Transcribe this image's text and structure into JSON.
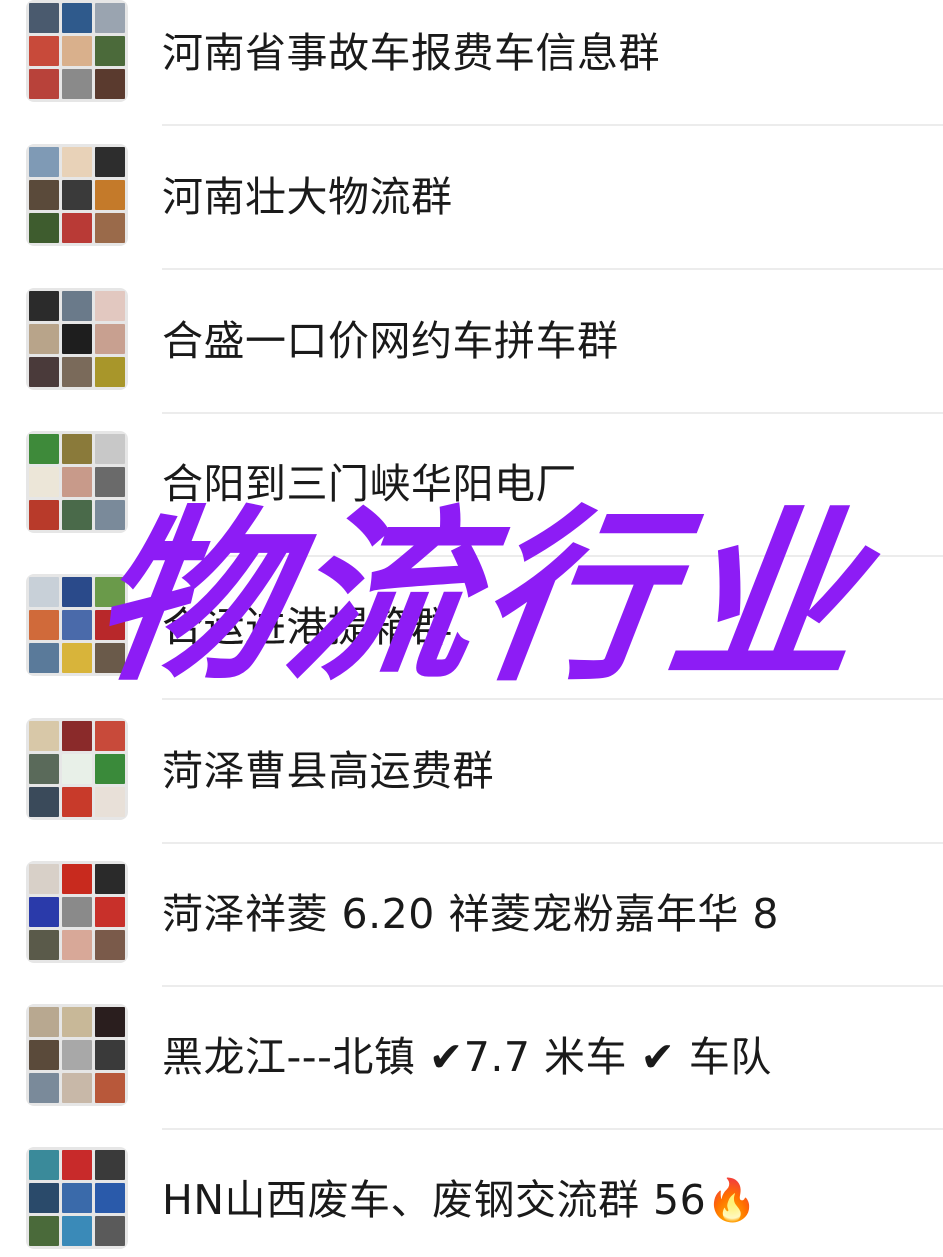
{
  "watermark": {
    "text": "物流行业",
    "color": "#8d1cf5"
  },
  "groups": [
    {
      "name": "河南省事故车报费车信息群",
      "avatar_icon": "group-avatar-grid-icon",
      "tiles": [
        "#4a5a6e",
        "#2f5a8c",
        "#9aa4b0",
        "#c84a3a",
        "#d9b08c",
        "#4b6a3a",
        "#b8423a",
        "#8a8a8a",
        "#5a3a2e"
      ]
    },
    {
      "name": "河南壮大物流群",
      "avatar_icon": "group-avatar-grid-icon",
      "tiles": [
        "#7f9ab5",
        "#e8d2b8",
        "#2d2d2d",
        "#5a4a3a",
        "#3a3a3a",
        "#c47a2a",
        "#3e5c2e",
        "#b93a36",
        "#9a6a4a"
      ]
    },
    {
      "name": "合盛一口价网约车拼车群",
      "avatar_icon": "group-avatar-grid-icon",
      "tiles": [
        "#2b2b2b",
        "#6a7a8a",
        "#e2c8c0",
        "#b8a48a",
        "#1e1e1e",
        "#c8a090",
        "#4a3a3a",
        "#7a6a5a",
        "#a8962a"
      ]
    },
    {
      "name": "合阳到三门峡华阳电厂",
      "avatar_icon": "group-avatar-grid-icon",
      "tiles": [
        "#3e8a3a",
        "#8a7a3a",
        "#c8c8c8",
        "#ece6d8",
        "#c89a8a",
        "#6a6a6a",
        "#b83a2a",
        "#4a6a4a",
        "#7a8a9a"
      ]
    },
    {
      "name": "合运进港提箱群",
      "avatar_icon": "group-avatar-grid-icon",
      "tiles": [
        "#c8d0d8",
        "#2a4a8a",
        "#6a9a4a",
        "#d06a3a",
        "#4a6aaa",
        "#b8282a",
        "#5a7a9a",
        "#d8b43a",
        "#6a5a4a"
      ]
    },
    {
      "name": "菏泽曹县高运费群",
      "avatar_icon": "group-avatar-grid-icon",
      "tiles": [
        "#d8c8a8",
        "#8a2a2a",
        "#c84a3a",
        "#5a6a5a",
        "#e8f0e8",
        "#3a8a3a",
        "#3a4a5a",
        "#c83a2a",
        "#e8e0d8"
      ]
    },
    {
      "name": "菏泽祥菱 6.20 祥菱宠粉嘉年华 8",
      "avatar_icon": "group-avatar-grid-icon",
      "tiles": [
        "#d8d0c8",
        "#c82a1e",
        "#2a2a2a",
        "#2a3aaa",
        "#8a8a8a",
        "#c8302a",
        "#5a5a4a",
        "#d8a898",
        "#7a5a4a"
      ]
    },
    {
      "name": "黑龙江---北镇 ✔7.7 米车 ✔ 车队",
      "avatar_icon": "group-avatar-grid-icon",
      "tiles": [
        "#b8a890",
        "#c8b898",
        "#2a1e1e",
        "#5a4a3a",
        "#a8a8a8",
        "#3a3a3a",
        "#7a8a9a",
        "#c8b8a8",
        "#b8583a"
      ]
    },
    {
      "name": "HN山西废车、废钢交流群 56🔥",
      "avatar_icon": "group-avatar-grid-icon",
      "tiles": [
        "#3a8a9a",
        "#c82a2a",
        "#3a3a3a",
        "#2a4a6a",
        "#3a6aaa",
        "#2a5aaa",
        "#4a6a3a",
        "#3a8ab8",
        "#5a5a5a"
      ]
    }
  ]
}
